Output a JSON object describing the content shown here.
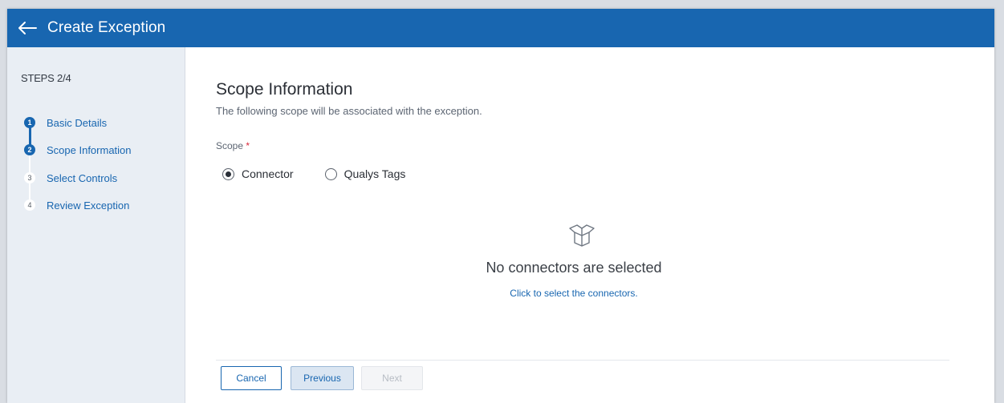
{
  "header": {
    "title": "Create Exception"
  },
  "sidebar": {
    "steps_label": "STEPS 2/4",
    "steps": [
      {
        "num": "1",
        "label": "Basic Details",
        "state": "complete"
      },
      {
        "num": "2",
        "label": "Scope Information",
        "state": "active"
      },
      {
        "num": "3",
        "label": "Select Controls",
        "state": "pending"
      },
      {
        "num": "4",
        "label": "Review Exception",
        "state": "pending"
      }
    ]
  },
  "main": {
    "title": "Scope Information",
    "subtitle": "The following scope will be associated with the exception.",
    "scope_label": "Scope",
    "required_mark": "*",
    "options": [
      {
        "label": "Connector",
        "selected": true
      },
      {
        "label": "Qualys Tags",
        "selected": false
      }
    ],
    "empty_state": {
      "icon": "open-box-icon",
      "title": "No connectors are selected",
      "link": "Click to select the connectors."
    }
  },
  "footer": {
    "cancel_label": "Cancel",
    "previous_label": "Previous",
    "next_label": "Next"
  },
  "colors": {
    "brand": "#1866b0",
    "sidebar_bg": "#e9eef4",
    "required": "#d9283a"
  }
}
